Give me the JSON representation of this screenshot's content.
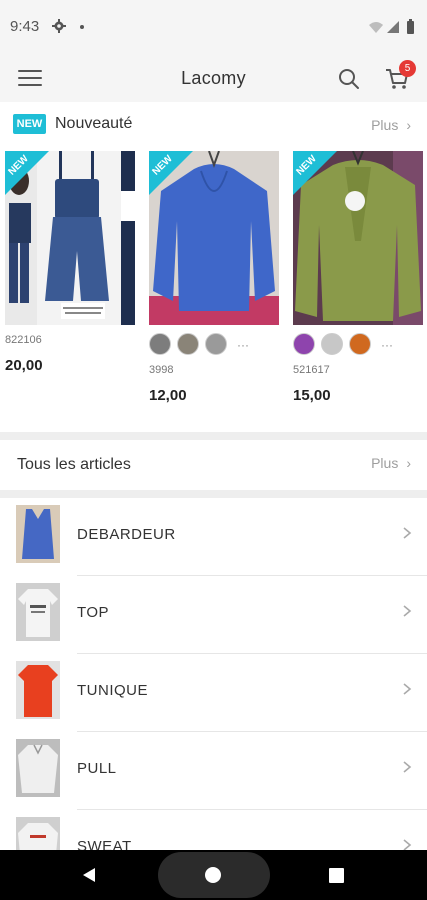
{
  "status": {
    "time": "9:43"
  },
  "header": {
    "title": "Lacomy",
    "cart_count": "5"
  },
  "new_section": {
    "tag": "NEW",
    "title": "Nouveauté",
    "more": "Plus",
    "ribbon": "NEW",
    "products": [
      {
        "ref": "822106",
        "price": "20,00",
        "swatches": []
      },
      {
        "ref": "3998",
        "price": "12,00",
        "swatches": [
          "#7d7d7d",
          "#8a8478",
          "#9a9a9a"
        ]
      },
      {
        "ref": "521617",
        "price": "15,00",
        "swatches": [
          "#8e44ad",
          "#c7c7c7",
          "#d0691f"
        ]
      }
    ],
    "more_swatches": "···"
  },
  "all_articles": {
    "title": "Tous les articles",
    "more": "Plus"
  },
  "categories": [
    {
      "label": "DEBARDEUR"
    },
    {
      "label": "TOP"
    },
    {
      "label": "TUNIQUE"
    },
    {
      "label": "PULL"
    },
    {
      "label": "SWEAT"
    }
  ],
  "colors": {
    "accent": "#1ebed6",
    "badge": "#e53935"
  }
}
